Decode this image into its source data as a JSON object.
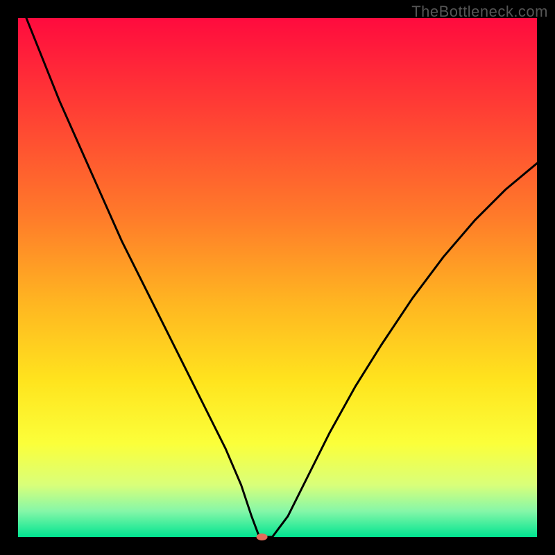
{
  "watermark": "TheBottleneck.com",
  "chart_data": {
    "type": "line",
    "title": "",
    "xlabel": "",
    "ylabel": "",
    "xlim": [
      0,
      100
    ],
    "ylim": [
      0,
      100
    ],
    "grid": false,
    "background_gradient": {
      "stops": [
        {
          "offset": 0.0,
          "color": "#ff0b3e"
        },
        {
          "offset": 0.18,
          "color": "#ff3f34"
        },
        {
          "offset": 0.38,
          "color": "#ff7a2a"
        },
        {
          "offset": 0.55,
          "color": "#ffb621"
        },
        {
          "offset": 0.7,
          "color": "#ffe41e"
        },
        {
          "offset": 0.82,
          "color": "#fbff3a"
        },
        {
          "offset": 0.9,
          "color": "#d9ff7a"
        },
        {
          "offset": 0.95,
          "color": "#86f7a8"
        },
        {
          "offset": 1.0,
          "color": "#00e491"
        }
      ]
    },
    "marker": {
      "x": 47,
      "y": 0,
      "color": "#e36b5b",
      "rx": 8,
      "ry": 5
    },
    "series": [
      {
        "name": "bottleneck-curve",
        "stroke": "#000000",
        "stroke_width": 3,
        "x": [
          0,
          4,
          8,
          12,
          16,
          20,
          24,
          28,
          32,
          36,
          40,
          43,
          45,
          46.5,
          49,
          52,
          56,
          60,
          65,
          70,
          76,
          82,
          88,
          94,
          100
        ],
        "y": [
          104,
          94,
          84,
          75,
          66,
          57,
          49,
          41,
          33,
          25,
          17,
          10,
          4,
          0,
          0,
          4,
          12,
          20,
          29,
          37,
          46,
          54,
          61,
          67,
          72
        ]
      }
    ]
  },
  "frame": {
    "outer_size": 800,
    "plot_margin": 26,
    "plot_size": 748
  }
}
